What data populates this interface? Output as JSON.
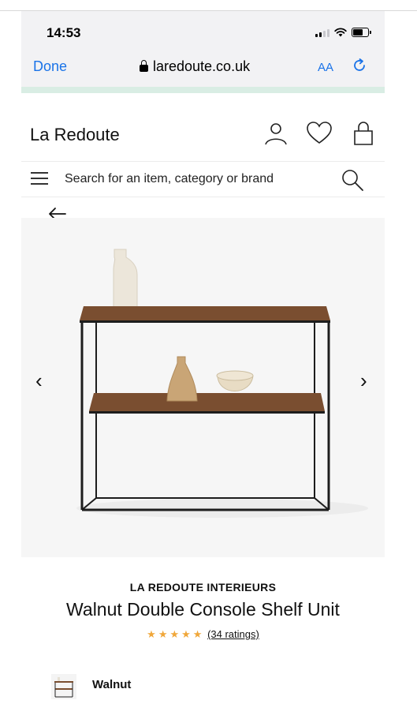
{
  "status_bar": {
    "time": "14:53"
  },
  "browser": {
    "done_label": "Done",
    "url": "laredoute.co.uk",
    "text_size_label": "AA"
  },
  "site": {
    "brand": "La Redoute",
    "search_placeholder": "Search for an item, category or brand"
  },
  "gallery": {
    "prev_label": "‹",
    "next_label": "›"
  },
  "product": {
    "brand": "LA REDOUTE INTERIEURS",
    "title": "Walnut Double Console Shelf Unit",
    "rating_stars": 4.5,
    "ratings_text": "(34 ratings)",
    "colour": "Walnut"
  },
  "colors": {
    "link_blue": "#1a73e8",
    "star_orange": "#f0a73a",
    "progress_green": "#d9ede4"
  }
}
